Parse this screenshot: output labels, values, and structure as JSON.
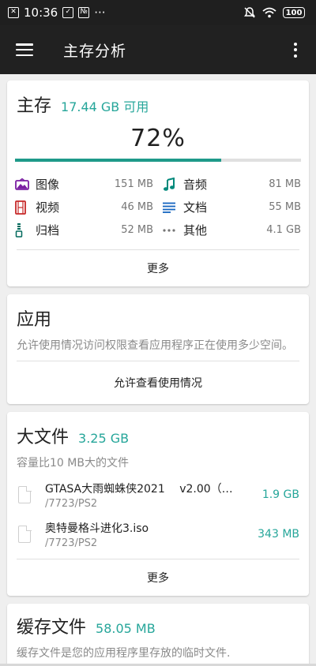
{
  "status_bar": {
    "time": "10:36",
    "dots": "···",
    "battery": "100"
  },
  "app_bar": {
    "title": "主存分析"
  },
  "storage_card": {
    "title": "主存",
    "available": "17.44 GB 可用",
    "percent_label": "72%",
    "used_fraction": 0.72,
    "categories": [
      {
        "label": "图像",
        "size": "151 MB",
        "icon": "image-icon",
        "color": "#7b1fa2"
      },
      {
        "label": "音频",
        "size": "81 MB",
        "icon": "music-note-icon",
        "color": "#00897b"
      },
      {
        "label": "视频",
        "size": "46 MB",
        "icon": "film-icon",
        "color": "#c62828"
      },
      {
        "label": "文档",
        "size": "55 MB",
        "icon": "document-lines-icon",
        "color": "#1565c0"
      },
      {
        "label": "归档",
        "size": "52 MB",
        "icon": "archive-zip-icon",
        "color": "#00695c"
      },
      {
        "label": "其他",
        "size": "4.1 GB",
        "icon": "more-horiz-icon",
        "color": "#757575"
      }
    ],
    "more_button": "更多"
  },
  "apps_card": {
    "title": "应用",
    "description": "允许使用情况访问权限查看应用程序正在使用多少空间。",
    "action_button": "允许查看使用情况"
  },
  "large_files_card": {
    "title": "大文件",
    "total": "3.25 GB",
    "description": "容量比10 MB大的文件",
    "files": [
      {
        "name": "GTASA大雨蜘蛛侠2021　 v2.00（…",
        "path": "/7723/PS2",
        "size": "1.9 GB"
      },
      {
        "name": "奥特曼格斗进化3.iso",
        "path": "/7723/PS2",
        "size": "343 MB"
      }
    ],
    "more_button": "更多"
  },
  "cache_card": {
    "title": "缓存文件",
    "total": "58.05 MB",
    "description": "缓存文件是您的应用程序里存放的临时文件."
  }
}
